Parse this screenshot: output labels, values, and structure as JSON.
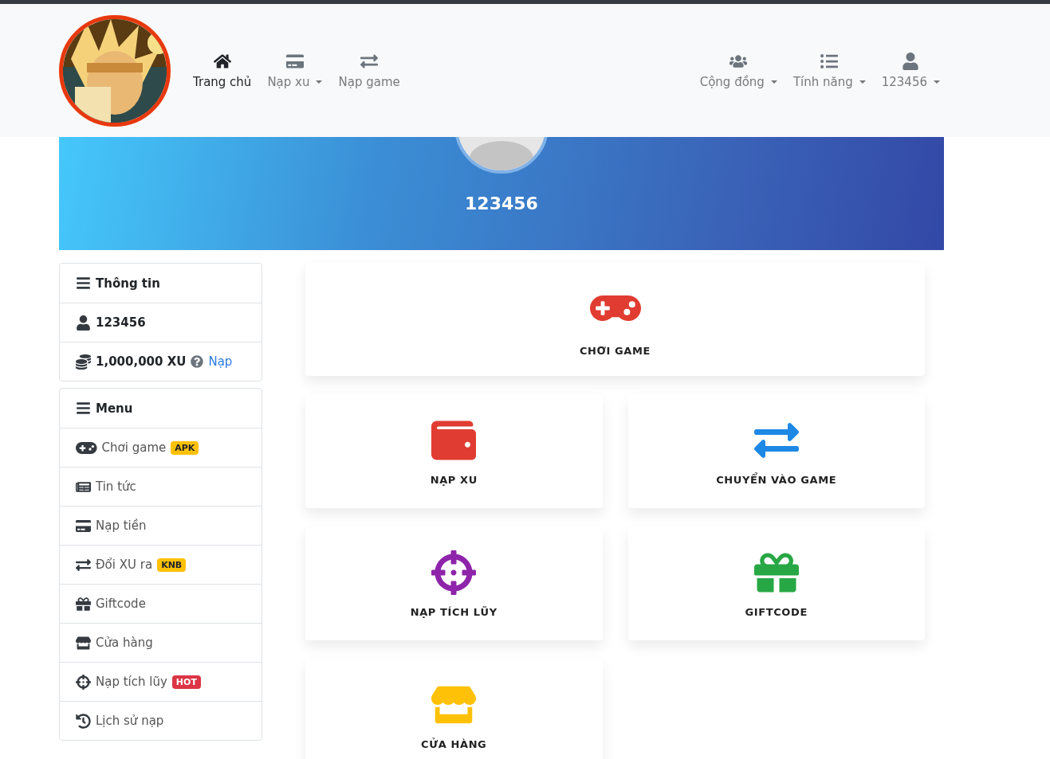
{
  "navbar": {
    "left": [
      {
        "label": "Trang chủ",
        "selected": true,
        "caret": false
      },
      {
        "label": "Nạp xu",
        "selected": false,
        "caret": true
      },
      {
        "label": "Nạp game",
        "selected": false,
        "caret": false
      }
    ],
    "right": [
      {
        "label": "Cộng đồng",
        "selected": false,
        "caret": true
      },
      {
        "label": "Tính năng",
        "selected": false,
        "caret": true
      },
      {
        "label": "123456",
        "selected": false,
        "caret": true
      }
    ]
  },
  "banner": {
    "username": "123456"
  },
  "info_card": {
    "title": "Thông tin",
    "username": "123456",
    "balance": "1,000,000 XU",
    "topup_link": "Nạp"
  },
  "menu_card": {
    "title": "Menu",
    "items": [
      {
        "label": "Chơi game",
        "badge": {
          "text": "APK",
          "color": "#ffc107"
        }
      },
      {
        "label": "Tin tức"
      },
      {
        "label": "Nạp tiền"
      },
      {
        "label": "Đổi XU ra",
        "badge": {
          "text": "KNB",
          "color": "#ffc107"
        }
      },
      {
        "label": "Giftcode"
      },
      {
        "label": "Cửa hàng"
      },
      {
        "label": "Nạp tích lũy",
        "badge": {
          "text": "HOT",
          "color": "#dc3545"
        }
      },
      {
        "label": "Lịch sử nạp"
      }
    ]
  },
  "tiles": [
    {
      "label": "CHƠI GAME",
      "color": "#e03c31"
    },
    {
      "label": "NẠP XU",
      "color": "#e03c31"
    },
    {
      "label": "CHUYỂN VÀO GAME",
      "color": "#1e88e5"
    },
    {
      "label": "NẠP TÍCH LŨY",
      "color": "#8e24aa"
    },
    {
      "label": "GIFTCODE",
      "color": "#28a745"
    },
    {
      "label": "CỬA HÀNG",
      "color": "#ffc107"
    }
  ]
}
